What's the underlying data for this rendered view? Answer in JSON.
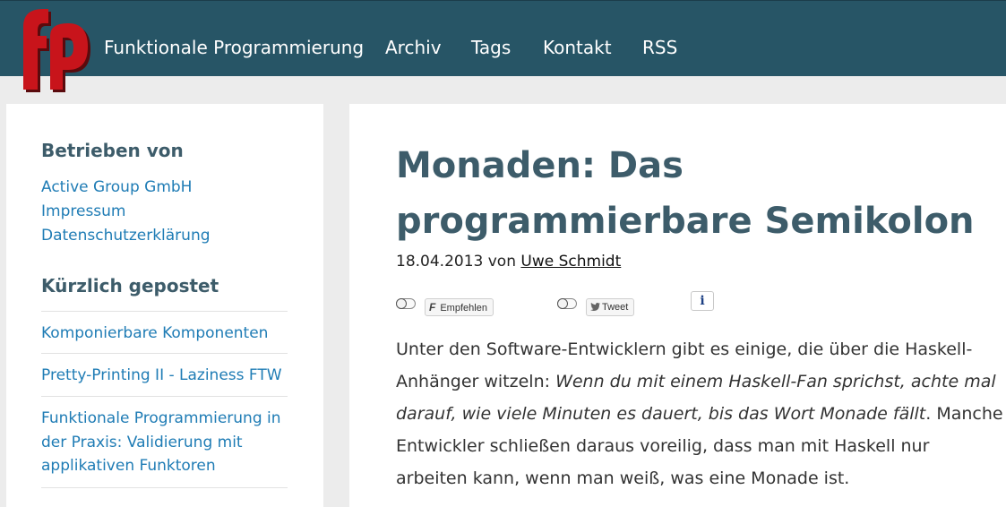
{
  "nav": {
    "logo_text": "fp",
    "items": [
      {
        "label": "Funktionale Programmierung"
      },
      {
        "label": "Archiv"
      },
      {
        "label": "Tags"
      },
      {
        "label": "Kontakt"
      },
      {
        "label": "RSS"
      }
    ]
  },
  "sidebar": {
    "powered_heading": "Betrieben von",
    "powered_links": [
      "Active Group GmbH",
      "Impressum",
      "Datenschutzerklärung"
    ],
    "recent_heading": "Kürzlich gepostet",
    "recent_posts": [
      "Komponierbare Komponenten",
      "Pretty-Printing II - Laziness FTW",
      "Funktionale Programmierung in",
      "der Praxis: Validierung mit",
      "applikativen Funktoren"
    ]
  },
  "article": {
    "title_line1": "Monaden: Das",
    "title_line2": "programmierbare Semikolon",
    "date": "18.04.2013",
    "by": "von",
    "author": "Uwe Schmidt",
    "share": {
      "facebook_icon_glyph": "F",
      "facebook_label": "Empfehlen",
      "twitter_label": "Tweet",
      "info_label": "i"
    },
    "body": {
      "l1": "Unter den Software-Entwicklern gibt es einige, die über die Haskell-",
      "l2_plain": "Anhänger witzeln: ",
      "l2_em": "Wenn du mit einem Haskell-Fan sprichst, achte mal",
      "l3_em": "darauf, wie viele Minuten es dauert, bis das Wort Monade fällt",
      "l3_plain": ". Manche",
      "l4": "Entwickler schließen daraus voreilig, dass man mit Haskell nur",
      "l5": "arbeiten kann, wenn man weiß, was eine Monade ist."
    }
  },
  "colors": {
    "header_bg": "#275566",
    "heading": "#3d5c6a",
    "link": "#1f7cb5",
    "logo_red": "#c8141b"
  }
}
